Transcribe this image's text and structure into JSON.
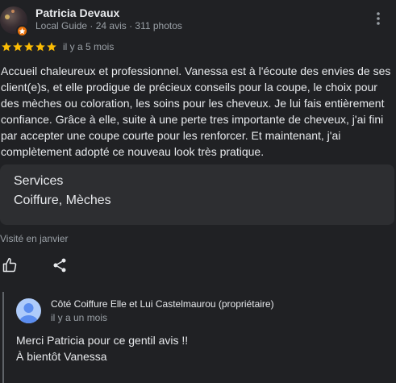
{
  "review": {
    "author_name": "Patricia Devaux",
    "author_meta": "Local Guide · 24 avis · 311 photos",
    "rating": 5,
    "rating_max": 5,
    "star_color": "#fbbc04",
    "when": "il y a 5 mois",
    "text": "Accueil chaleureux et professionnel. Vanessa est à l'écoute des envies de ses client(e)s, et elle prodigue de précieux conseils pour la coupe, le choix pour des mèches ou coloration, les soins pour les cheveux. Je lui fais entièrement confiance. Grâce à elle, suite à une perte tres importante de cheveux, j'ai fini par accepter une coupe courte pour les renforcer. Et maintenant, j'ai complètement adopté ce nouveau look très pratique.",
    "services_title": "Services",
    "services_value": "Coiffure, Mèches",
    "visited": "Visité en janvier",
    "icons": {
      "more": "more-vert-icon",
      "like": "thumb-up-icon",
      "share": "share-icon",
      "badge": "local-guide-badge-icon"
    },
    "badge_color": "#e8710a"
  },
  "owner_reply": {
    "name": "Côté Coiffure Elle et Lui Castelmaurou (propriétaire)",
    "when": "il y a un mois",
    "line1": "Merci Patricia pour ce gentil avis !!",
    "line2": "À bientôt Vanessa",
    "avatar_color": "#aecbfa"
  }
}
